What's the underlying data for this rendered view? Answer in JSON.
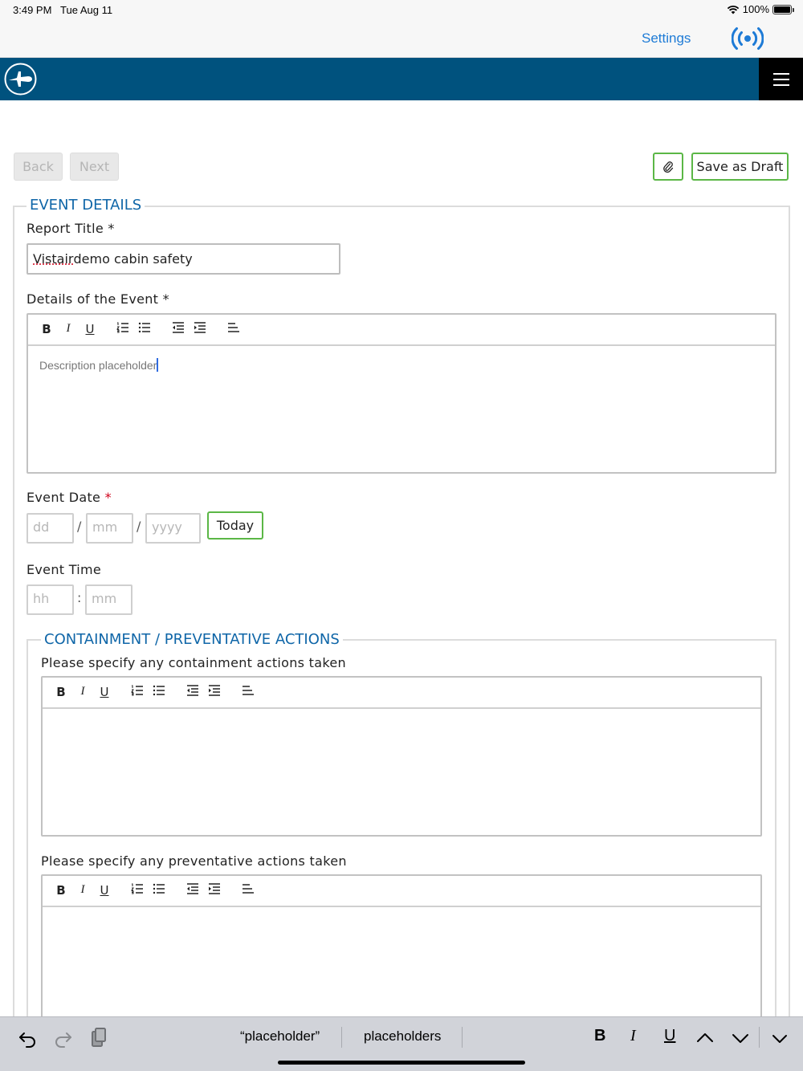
{
  "status": {
    "time": "3:49 PM",
    "date": "Tue Aug 11",
    "battery": "100%",
    "battery_level": 1.0
  },
  "nav": {
    "settings_label": "Settings",
    "broadcast_icon": "broadcast-icon"
  },
  "header": {
    "logo_icon": "airplane-logo-icon",
    "menu_icon": "hamburger-menu-icon",
    "brand_color": "#00527e"
  },
  "actions": {
    "back_label": "Back",
    "next_label": "Next",
    "attach_icon": "paperclip-icon",
    "save_draft_label": "Save as Draft"
  },
  "event_details": {
    "legend": "EVENT DETAILS",
    "report_title_label": "Report Title *",
    "report_title_value_word1": "Vistair",
    "report_title_value_rest": " demo cabin safety",
    "details_label": "Details of the Event *",
    "details_value": "Description placeholder",
    "event_date_label": "Event Date",
    "required_mark": "*",
    "date_placeholders": {
      "day": "dd",
      "month": "mm",
      "year": "yyyy"
    },
    "date_separator": "/",
    "today_label": "Today",
    "event_time_label": "Event Time",
    "time_placeholders": {
      "hour": "hh",
      "minute": "mm"
    },
    "time_separator": ":"
  },
  "toolbar_icons": [
    "bold",
    "italic",
    "underline",
    "ordered-list",
    "unordered-list",
    "outdent",
    "indent",
    "align-left"
  ],
  "toolbar_text": {
    "bold": "B",
    "italic": "I",
    "underline": "U"
  },
  "containment": {
    "legend": "CONTAINMENT / PREVENTATIVE ACTIONS",
    "containment_label": "Please specify any containment actions taken",
    "preventative_label": "Please specify any preventative actions taken"
  },
  "keyboard_bar": {
    "suggestion_1": "“placeholder”",
    "suggestion_2": "placeholders",
    "bold": "B",
    "italic": "I",
    "underline": "U",
    "icons": [
      "undo-icon",
      "redo-icon",
      "paste-icon",
      "chevron-up-icon",
      "chevron-down-icon",
      "dismiss-keyboard-icon"
    ]
  },
  "colors": {
    "accent": "#0f66a8",
    "link": "#1e7bd6",
    "green_border": "#5bb746",
    "required": "#d0021b"
  }
}
